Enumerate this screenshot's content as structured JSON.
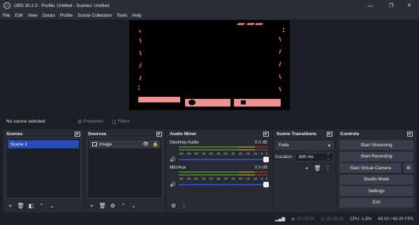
{
  "window": {
    "title": "OBS 30.2.3 - Profile: Untitled - Scenes: Untitled",
    "minimize": "—",
    "maximize": "❐",
    "close": "✕"
  },
  "menu": [
    "File",
    "Edit",
    "View",
    "Docks",
    "Profile",
    "Scene Collection",
    "Tools",
    "Help"
  ],
  "source_toolbar": {
    "no_source": "No source selected",
    "properties": "Properties",
    "filters": "Filters"
  },
  "scenes": {
    "title": "Scenes",
    "items": [
      "Scene 2"
    ]
  },
  "sources": {
    "title": "Sources",
    "items": [
      {
        "name": "Image",
        "icon": "image-icon"
      }
    ]
  },
  "audio_mixer": {
    "title": "Audio Mixer",
    "scale": [
      "-60",
      "-55",
      "-50",
      "-45",
      "-40",
      "-35",
      "-30",
      "-25",
      "-20",
      "-15",
      "-10",
      "-5",
      "0"
    ],
    "channels": [
      {
        "name": "Desktop Audio",
        "db": "0.0 dB",
        "volume": 1.0
      },
      {
        "name": "Mic/Aux",
        "db": "0.0 dB",
        "volume": 1.0
      }
    ]
  },
  "transitions": {
    "title": "Scene Transitions",
    "selected": "Fade",
    "duration_label": "Duration",
    "duration_value": "300 ms"
  },
  "controls": {
    "title": "Controls",
    "start_streaming": "Start Streaming",
    "start_recording": "Start Recording",
    "start_virtual_camera": "Start Virtual Camera",
    "studio_mode": "Studio Mode",
    "settings": "Settings",
    "exit": "Exit"
  },
  "status": {
    "stream_time": "00:00:00",
    "record_time": "00:00:00",
    "cpu": "CPU: 1.9%",
    "fps": "60.00 / 60.00 FPS"
  },
  "colors": {
    "accent": "#284cb8",
    "pink": "#f0607a",
    "peach": "#f09090"
  }
}
